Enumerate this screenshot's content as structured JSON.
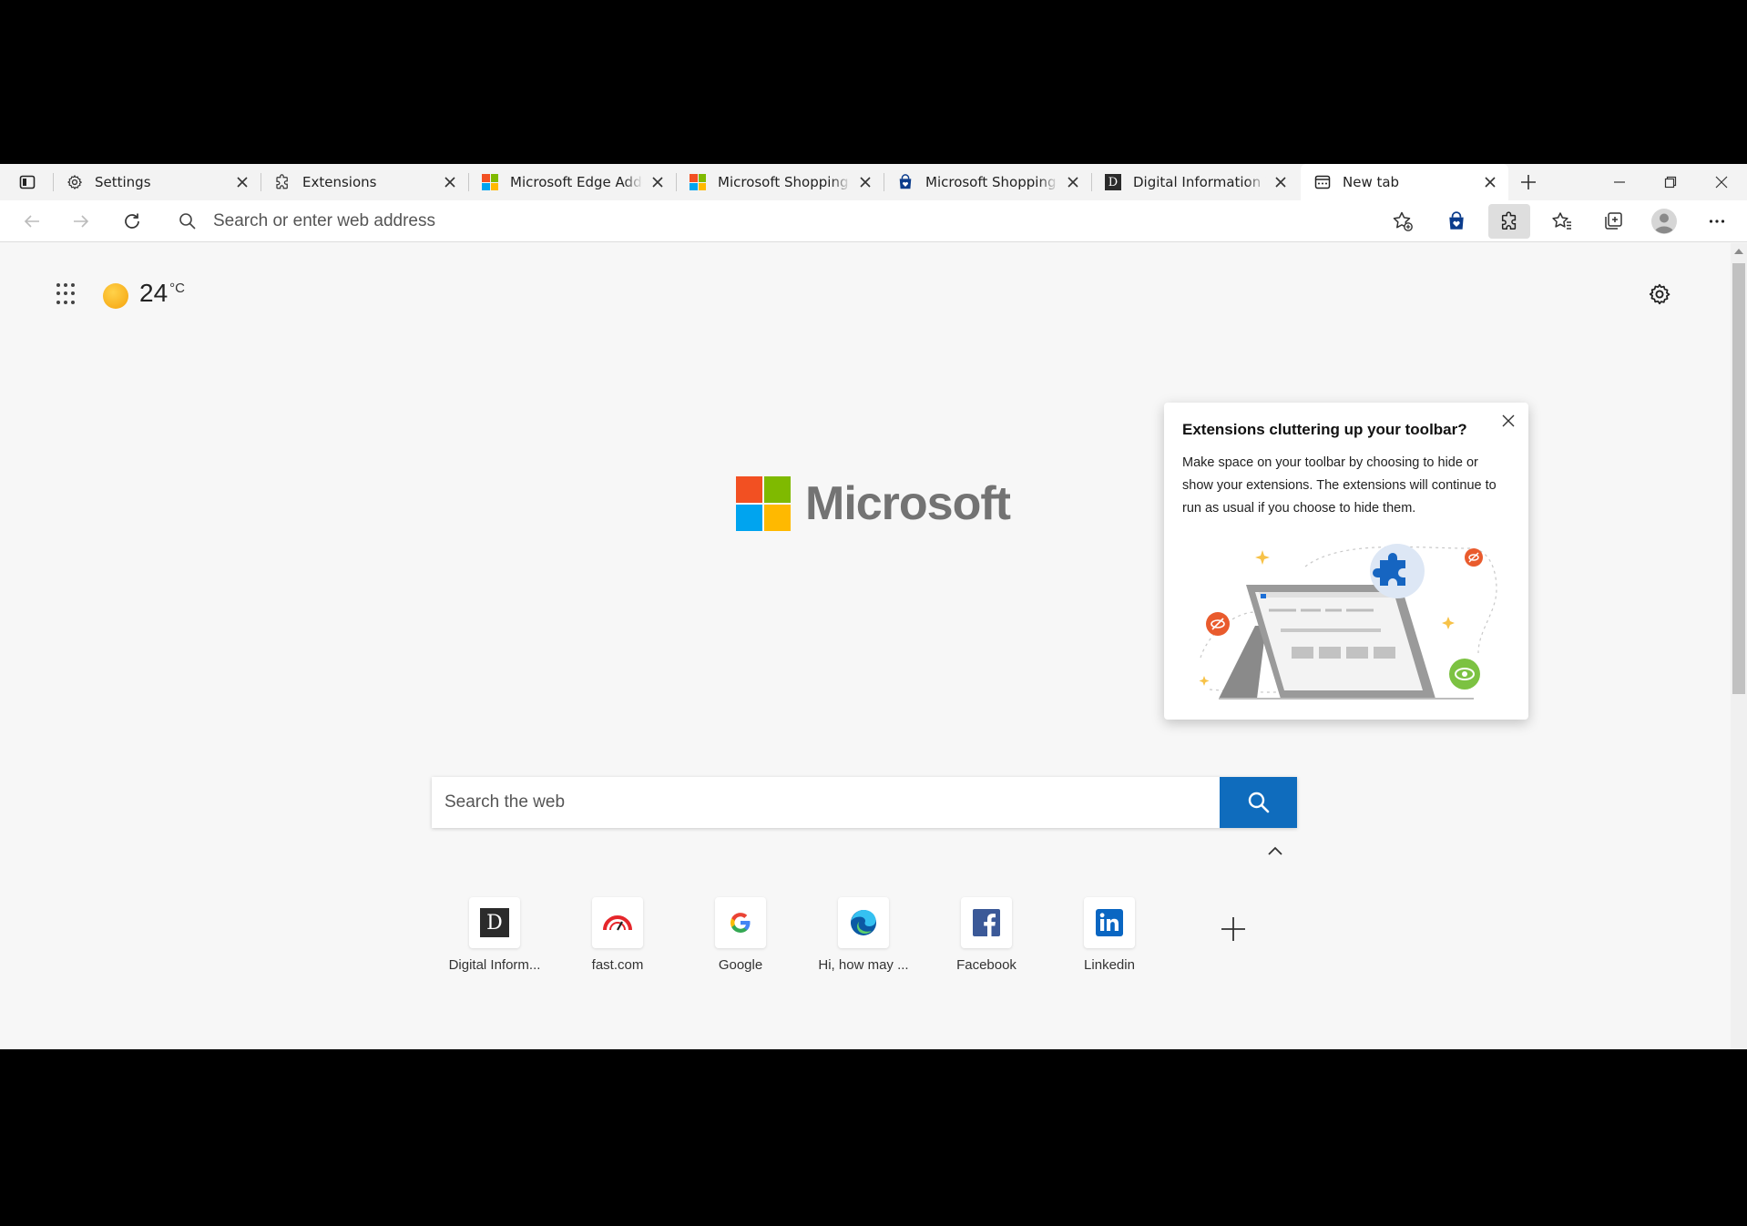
{
  "tabs": [
    {
      "title": "Settings",
      "favicon": "gear-icon"
    },
    {
      "title": "Extensions",
      "favicon": "puzzle-icon"
    },
    {
      "title": "Microsoft Edge Add-ons",
      "favicon": "microsoft-logo-icon"
    },
    {
      "title": "Microsoft Shopping Add-on",
      "favicon": "microsoft-logo-icon"
    },
    {
      "title": "Microsoft Shopping Add-on",
      "favicon": "shopping-bag-icon"
    },
    {
      "title": "Digital Information World",
      "favicon": "d-letter-icon"
    },
    {
      "title": "New tab",
      "favicon": "new-tab-icon",
      "active": true
    }
  ],
  "address_bar": {
    "placeholder": "Search or enter web address"
  },
  "weather": {
    "temperature": "24",
    "unit": "°C"
  },
  "logo_text": "Microsoft",
  "web_search": {
    "placeholder": "Search the web"
  },
  "quick_links": [
    {
      "label": "Digital Inform...",
      "icon": "d-letter-icon"
    },
    {
      "label": "fast.com",
      "icon": "speedometer-icon"
    },
    {
      "label": "Google",
      "icon": "google-g-icon"
    },
    {
      "label": "Hi, how may ...",
      "icon": "edge-logo-icon"
    },
    {
      "label": "Facebook",
      "icon": "facebook-icon"
    },
    {
      "label": "Linkedin",
      "icon": "linkedin-icon"
    }
  ],
  "popup": {
    "title": "Extensions cluttering up your toolbar?",
    "body": "Make space on your toolbar by choosing to hide or show your extensions. The extensions will continue to run as usual if you choose to hide them."
  },
  "colors": {
    "accent": "#0f6cbd",
    "background": "#f7f7f7"
  }
}
